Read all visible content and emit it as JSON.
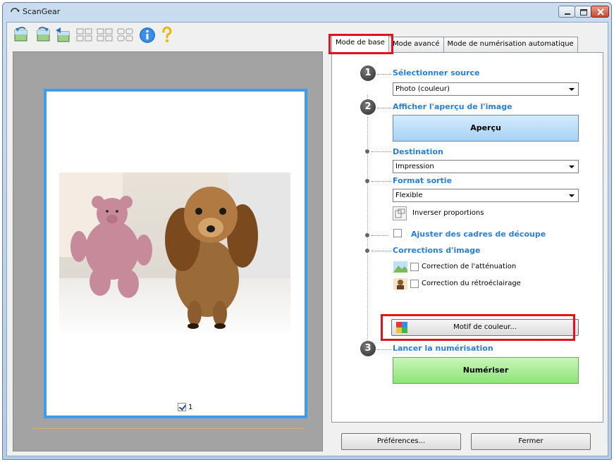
{
  "window": {
    "title": "ScanGear"
  },
  "toolbar": {
    "icons": [
      "rotate-left-icon",
      "rotate-right-icon",
      "mirror-icon",
      "thumbnail-view-icon",
      "whole-image-view-icon",
      "crop-frame-icon",
      "info-icon",
      "help-icon"
    ]
  },
  "preview": {
    "checkbox_label": "1",
    "checked": true
  },
  "tabs": [
    "Mode de base",
    "Mode avancé",
    "Mode de numérisation automatique"
  ],
  "steps": {
    "step1": {
      "number": "1",
      "title": "Sélectionner source",
      "value": "Photo (couleur)"
    },
    "step2": {
      "number": "2",
      "title": "Afficher l'aperçu de l'image",
      "button": "Aperçu"
    },
    "destination": {
      "title": "Destination",
      "value": "Impression"
    },
    "format": {
      "title": "Format sortie",
      "value": "Flexible",
      "invert_label": "Inverser proportions"
    },
    "crop": {
      "title": "Ajuster des cadres de découpe"
    },
    "corrections": {
      "title": "Corrections d'image",
      "fade": "Correction de l'atténuation",
      "backlight": "Correction du rétroéclairage",
      "color_pattern_button": "Motif de couleur..."
    },
    "step3": {
      "number": "3",
      "title": "Lancer la numérisation",
      "button": "Numériser"
    }
  },
  "footer": {
    "preferences": "Préférences...",
    "close": "Fermer"
  },
  "colors": {
    "accent_blue": "#2a7fd4",
    "highlight_red": "#e0141e",
    "preview_frame": "#3e9bf0"
  }
}
